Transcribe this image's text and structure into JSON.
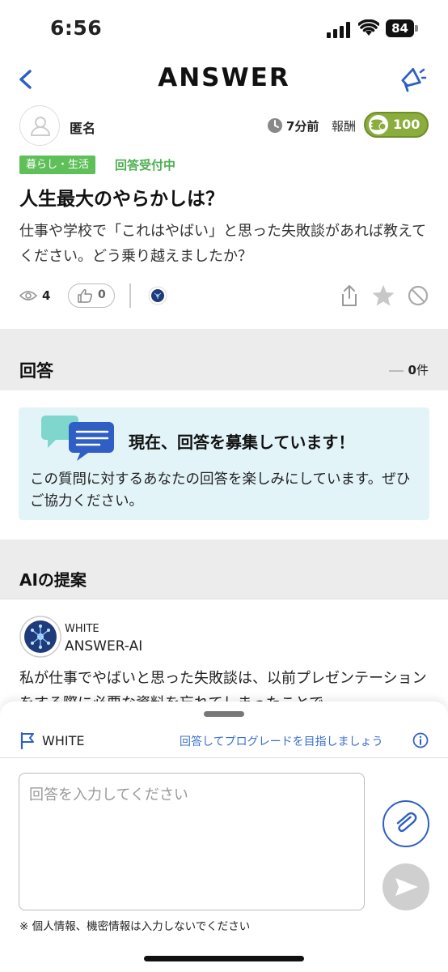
{
  "status_bar": {
    "time": "6:56",
    "battery": "84"
  },
  "header": {
    "logo": "ANSWER",
    "icons": [
      "chevron-left-icon",
      "megaphone-icon"
    ]
  },
  "question": {
    "user": "匿名",
    "time_ago": "7分前",
    "reward_label": "報酬",
    "reward_value": "100",
    "category": "暮らし・生活",
    "status": "回答受付中",
    "title": "人生最大のやらかしは？",
    "body": "仕事や学校で「これはやばい」と思った失敗談があれば教えてください。どう乗り越えましたか？",
    "views": "4",
    "likes": "0"
  },
  "answers": {
    "title": "回答",
    "count": "0",
    "count_unit": "件",
    "recruit_title": "現在、回答を募集しています！",
    "recruit_body": "この質問に対するあなたの回答を楽しみにしています。ぜひご協力ください。"
  },
  "ai": {
    "section_title": "AIの提案",
    "rank": "WHITE",
    "name": "ANSWER-AI",
    "body": "私が仕事でやばいと思った失敗談は、以前プレゼンテーションをする際に必要な資料を忘れてしまったことで"
  },
  "composer": {
    "rank": "WHITE",
    "upgrade_text": "回答してプログレードを目指しましょう",
    "placeholder": "回答を入力してください",
    "note": "※ 個人情報、機密情報は入力しないでください"
  },
  "colors": {
    "accent_blue": "#2f5fc4",
    "tag_green": "#5fbf59",
    "reward_green": "#8aad3d",
    "recruit_bg": "#e3f4f9"
  }
}
